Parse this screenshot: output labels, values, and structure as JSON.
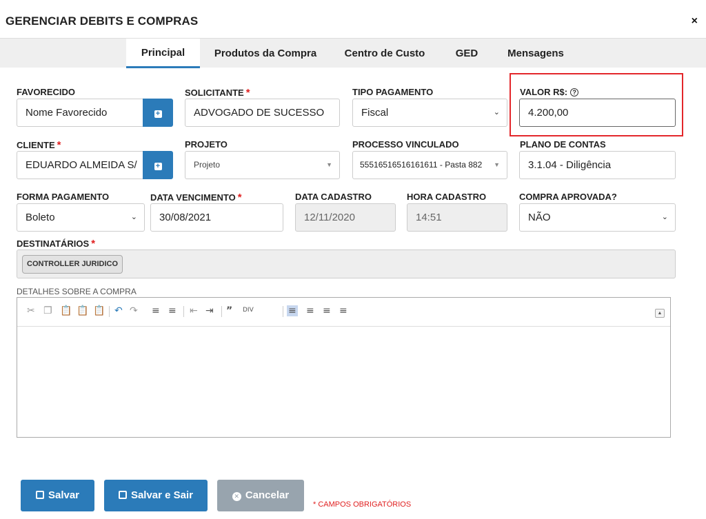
{
  "dialog": {
    "title": "GERENCIAR DEBITS E COMPRAS",
    "close": "×"
  },
  "tabs": [
    {
      "label": "Principal",
      "active": true
    },
    {
      "label": "Produtos da Compra"
    },
    {
      "label": "Centro de Custo"
    },
    {
      "label": "GED"
    },
    {
      "label": "Mensagens"
    }
  ],
  "fields": {
    "favorecido": {
      "label": "FAVORECIDO",
      "value": "Nome Favorecido"
    },
    "solicitante": {
      "label": "SOLICITANTE",
      "required": "*",
      "value": "ADVOGADO DE SUCESSO"
    },
    "tipo_pagamento": {
      "label": "TIPO PAGAMENTO",
      "value": "Fiscal"
    },
    "valor": {
      "label": "VALOR R$:",
      "help": "?",
      "value": "4.200,00"
    },
    "cliente": {
      "label": "CLIENTE",
      "required": "*",
      "value": "EDUARDO ALMEIDA S/"
    },
    "projeto": {
      "label": "PROJETO",
      "placeholder": "Projeto"
    },
    "processo": {
      "label": "PROCESSO VINCULADO",
      "value": "55516516516161611 - Pasta 882"
    },
    "plano": {
      "label": "PLANO DE CONTAS",
      "value": "3.1.04 - Diligência"
    },
    "forma_pagamento": {
      "label": "FORMA PAGAMENTO",
      "value": "Boleto"
    },
    "data_vencimento": {
      "label": "DATA VENCIMENTO",
      "required": "*",
      "value": "30/08/2021"
    },
    "data_cadastro": {
      "label": "DATA CADASTRO",
      "value": "12/11/2020"
    },
    "hora_cadastro": {
      "label": "HORA CADASTRO",
      "value": "14:51"
    },
    "compra_aprovada": {
      "label": "COMPRA APROVADA?",
      "value": "NÃO"
    },
    "destinatarios": {
      "label": "DESTINATÁRIOS",
      "required": "*",
      "chip": "CONTROLLER JURIDICO"
    },
    "detalhes": {
      "label": "DETALHES SOBRE A COMPRA"
    }
  },
  "buttons": {
    "salvar": "Salvar",
    "salvar_sair": "Salvar e Sair",
    "cancelar": "Cancelar"
  },
  "required_note": "* CAMPOS OBRIGATÓRIOS",
  "colors": {
    "primary": "#2b7bb9",
    "required": "#e02020",
    "highlight": "#e3262a",
    "disabled_button": "#98a4ae"
  }
}
